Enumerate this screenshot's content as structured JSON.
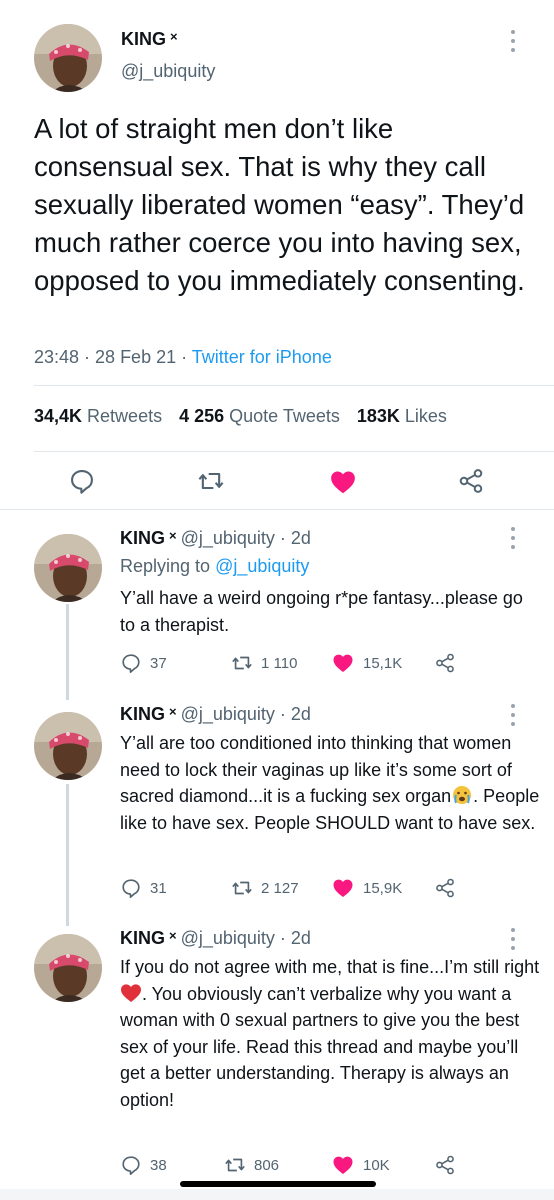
{
  "main_tweet": {
    "display_name": "KING",
    "name_mark": "×",
    "handle": "@j_ubiquity",
    "text": "A lot of straight men don’t like consensual sex. That is why they call sexually liberated women “easy”. They’d much rather coerce you into having sex, opposed to you immediately consenting.",
    "time": "23:48 · 28 Feb 21 · ",
    "source": "Twitter for iPhone",
    "stats": {
      "retweets_count": "34,4K",
      "retweets_label": "Retweets",
      "quotes_count": "4 256",
      "quotes_label": "Quote Tweets",
      "likes_count": "183K",
      "likes_label": "Likes"
    },
    "actions": [
      "reply-icon",
      "retweet-icon",
      "liked-heart-icon",
      "share-icon"
    ]
  },
  "replies": [
    {
      "display_name": "KING",
      "name_mark": "×",
      "handle_time": "@j_ubiquity · 2d",
      "replying_prefix": "Replying to ",
      "replying_to": "@j_ubiquity",
      "text": "Y’all have a weird ongoing r*pe fantasy...please go to a therapist.",
      "replies": "37",
      "retweets": "1 110",
      "likes": "15,1K"
    },
    {
      "display_name": "KING",
      "name_mark": "×",
      "handle_time": "@j_ubiquity · 2d",
      "text_before_emoji": "Y’all are too conditioned into thinking that women need to lock their vaginas up like it’s some sort of sacred diamond...it is a fucking sex organ",
      "emoji": "crying-face-emoji",
      "text_after_emoji": ". People like to have sex. People SHOULD want to have sex.",
      "replies": "31",
      "retweets": "2 127",
      "likes": "15,9K"
    },
    {
      "display_name": "KING",
      "name_mark": "×",
      "handle_time": "@j_ubiquity · 2d",
      "text_before_emoji": "If you do not agree with me, that is fine...I’m still right",
      "emoji": "red-heart-emoji",
      "text_after_emoji": ". You obviously can’t verbalize why you want a woman with 0 sexual partners to give you the best sex of your life. Read this thread and maybe you’ll get a better understanding. Therapy is always an option!",
      "replies": "38",
      "retweets": "806",
      "likes": "10K"
    }
  ],
  "colors": {
    "text": "#0f1419",
    "secondary": "#536471",
    "link": "#1d9bf0",
    "like": "#f91880",
    "divider": "#e1e6ea"
  }
}
